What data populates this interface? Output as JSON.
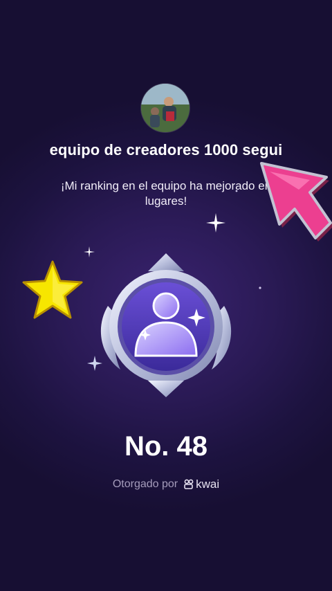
{
  "header": {
    "avatar_icon": "user-avatar-photo",
    "title": "equipo de creadores 1000 segui",
    "subtitle_line1": "¡Mi ranking en el equipo ha mejorado en",
    "subtitle_line2": "lugares!"
  },
  "badge": {
    "icon": "silver-user-medal-icon",
    "rank_text": "No. 48"
  },
  "footer": {
    "awarded_label": "Otorgado por",
    "brand_name": "kwai",
    "brand_icon": "kwai-logo-icon"
  },
  "decorations": {
    "star_icon": "yellow-star-sticker",
    "cursor_icon": "pink-arrow-cursor-sticker",
    "sparkle_icon": "sparkle-icon"
  },
  "colors": {
    "background": "#1d1340",
    "accent_pink": "#e8358b",
    "star_yellow": "#f5e000"
  }
}
